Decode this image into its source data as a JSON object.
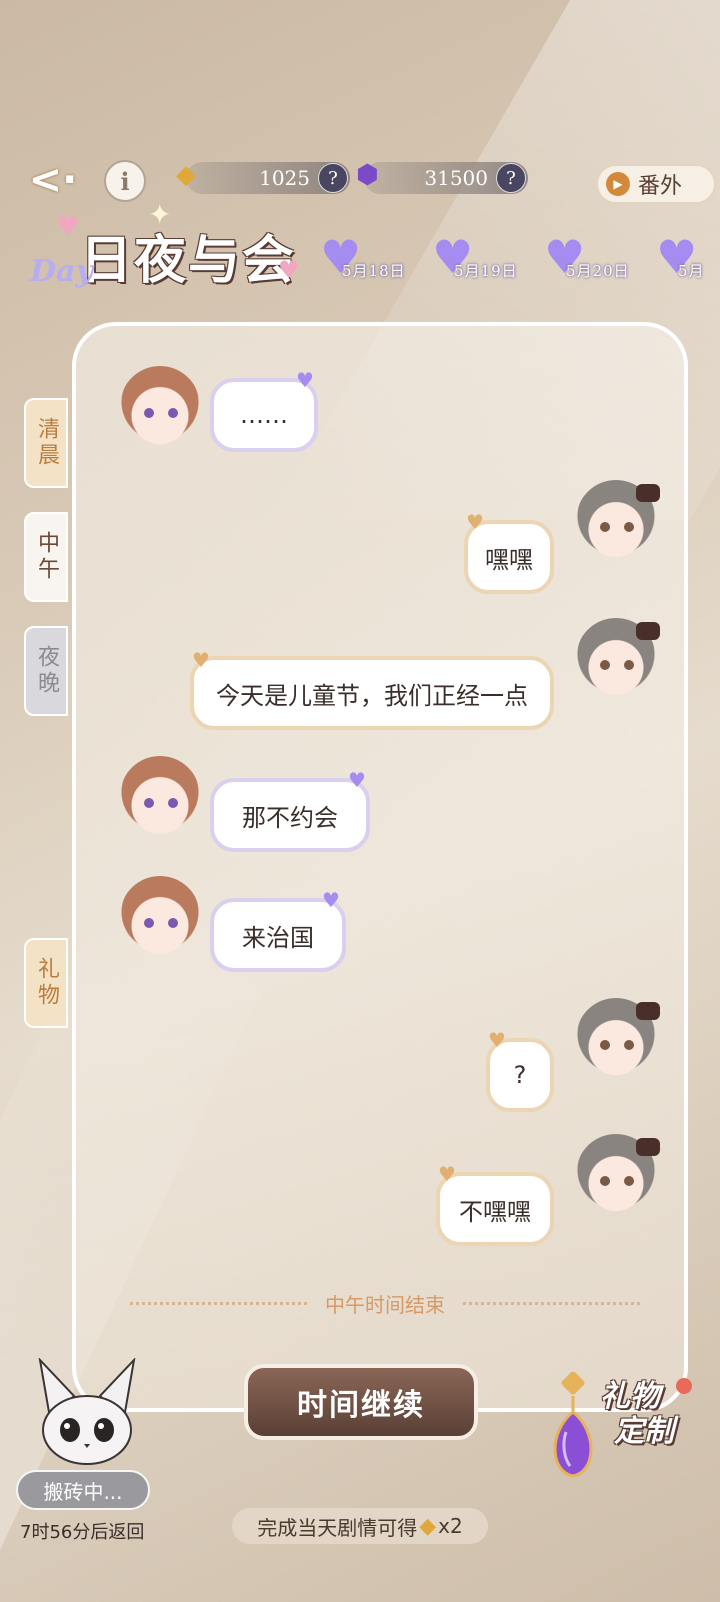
{
  "header": {
    "back_icon": "back-arrow-icon",
    "info_label": "i",
    "gold": {
      "amount": "1025",
      "help": "?"
    },
    "gem": {
      "amount": "31500",
      "help": "?"
    },
    "extra_label": "番外"
  },
  "logo": {
    "title": "日夜与会",
    "accent": "Day"
  },
  "dates": [
    "5月18日",
    "5月19日",
    "5月20日",
    "5月"
  ],
  "side_tabs": {
    "morning": "清晨",
    "noon": "中午",
    "night": "夜晚",
    "gift": "礼物"
  },
  "messages": [
    {
      "speaker": "male",
      "text": "……"
    },
    {
      "speaker": "female",
      "text": "嘿嘿"
    },
    {
      "speaker": "female",
      "text": "今天是儿童节，我们正经一点"
    },
    {
      "speaker": "male",
      "text": "那不约会"
    },
    {
      "speaker": "male",
      "text": "来治国"
    },
    {
      "speaker": "female",
      "text": "?"
    },
    {
      "speaker": "female",
      "text": "不嘿嘿"
    }
  ],
  "section_end": "中午时间结束",
  "continue_button": "时间继续",
  "reward_text": "完成当天剧情可得",
  "reward_multiplier": "x2",
  "pet": {
    "status": "搬砖中...",
    "timer": "7时56分后返回"
  },
  "gift_custom": {
    "line1": "礼物",
    "line2": "定制"
  },
  "colors": {
    "male_bubble_border": "#d9cfee",
    "female_bubble_border": "#ecd5b3",
    "heart_purple": "#a58cf0",
    "heart_gold": "#e0b070",
    "continue_button": "#6e5044"
  }
}
